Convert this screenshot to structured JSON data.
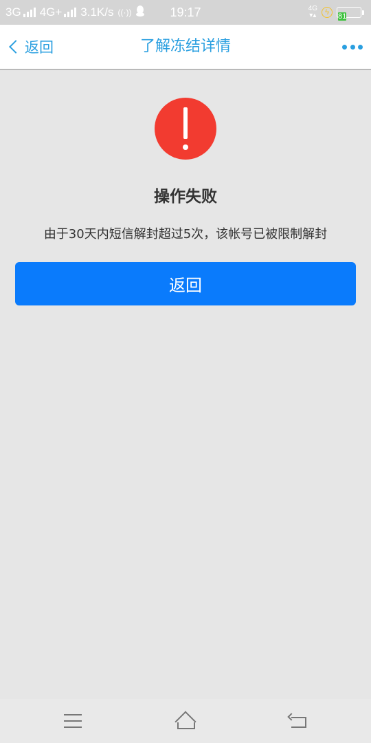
{
  "status_bar": {
    "network1": "3G",
    "network2": "4G+",
    "speed": "3.1K/s",
    "time": "19:17",
    "network_right": "4G",
    "battery_level": "81",
    "battery_color": "#3ec13e",
    "icons": [
      "signal-icon",
      "wireless-icon",
      "qq-icon",
      "charging-icon",
      "battery-icon"
    ]
  },
  "nav": {
    "back_label": "返回",
    "title": "了解冻结详情",
    "more_icon": "more-icon",
    "accent_color": "#2a9fe0"
  },
  "result": {
    "icon": "error-icon",
    "icon_color": "#f23b30",
    "title": "操作失败",
    "message": "由于30天内短信解封超过5次，该帐号已被限制解封"
  },
  "actions": {
    "return_label": "返回",
    "button_color": "#0a7bfc"
  },
  "system_nav": {
    "icons": [
      "menu-icon",
      "home-icon",
      "back-icon"
    ]
  }
}
